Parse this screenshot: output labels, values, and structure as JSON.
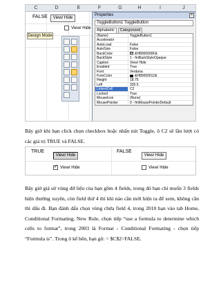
{
  "screenshot1": {
    "columns": [
      "C",
      "D",
      "E",
      "F",
      "G",
      "H",
      "I",
      "J"
    ],
    "cell_false": "FALSE",
    "toggle_label": "View/ Hide",
    "checkbox_label": "View/ Hide",
    "design_mode_label": "Design Mode",
    "properties": {
      "title": "Properties",
      "object": "ToggleButton1  ToggleButton",
      "tabs": [
        "Alphabetic",
        "Categorized"
      ],
      "rows": [
        {
          "name": "(Name)",
          "value": "ToggleButton1"
        },
        {
          "name": "Accelerator",
          "value": ""
        },
        {
          "name": "AutoLoad",
          "value": "False"
        },
        {
          "name": "AutoSize",
          "value": "False"
        },
        {
          "name": "BackColor",
          "value": "&H8000000F&",
          "swatch": "#d4d0c8"
        },
        {
          "name": "BackStyle",
          "value": "1 - fmBackStyleOpaque"
        },
        {
          "name": "Caption",
          "value": "View/ Hide"
        },
        {
          "name": "Enabled",
          "value": "True"
        },
        {
          "name": "Font",
          "value": "Verdana"
        },
        {
          "name": "ForeColor",
          "value": "&H80000012&",
          "swatch": "#000000"
        },
        {
          "name": "Height",
          "value": "18.75"
        },
        {
          "name": "Left",
          "value": "326.5"
        },
        {
          "name": "LinkedCell",
          "value": "C2",
          "highlight": true
        },
        {
          "name": "Locked",
          "value": "True"
        },
        {
          "name": "MouseIcon",
          "value": "(None)"
        },
        {
          "name": "MousePointer",
          "value": "0 - fmMousePointerDefault"
        }
      ]
    }
  },
  "paragraph1": "Bây giờ khi bạn click chọn checkbox hoặc nhấn nút Toggle, ô C2 sẽ lần lượt có các giá trị TRUE và FALSE.",
  "screenshot2": {
    "left_value": "TRUE",
    "left_toggle": "View/ Hide",
    "left_checkbox": "View/ Hide",
    "right_value": "FALSE",
    "right_toggle": "View/ Hide",
    "right_checkbox": "View/ Hide"
  },
  "paragraph2": "Bây giờ giả sử vùng dữ liệu của bạn gồm 4 fields, trong đó bạn chỉ muốn 3 fields hiện thường xuyên, còn field thứ 4 thì khi nào cần mới hiện ra để xem, không cần thì dấu đi. Bạn đánh dấu chọn vùng chứa field 4, trong 2010 bạn vào tab Home, Conditional Formating, New Rule, chọn tiếp “use a formula to determine which cells to format”, trong 2003 là Format - Conditional Formating - chọn tiếp “Formula is”. Trong ô kế bên, bạn gõ: = $C$2=FALSE."
}
